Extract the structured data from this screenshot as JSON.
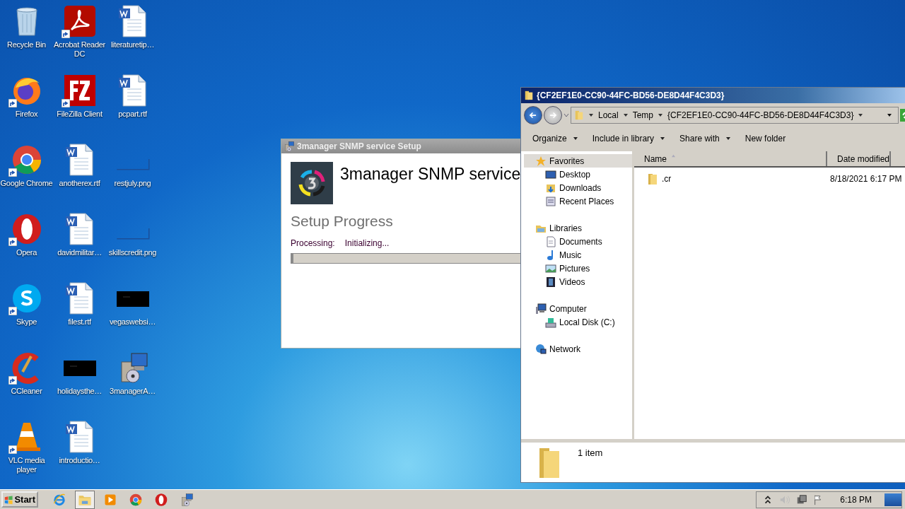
{
  "desktop": {
    "icons": [
      {
        "label": "Recycle Bin",
        "kind": "recycle",
        "shortcut": false
      },
      {
        "label": "Firefox",
        "kind": "firefox",
        "shortcut": true
      },
      {
        "label": "Google Chrome",
        "kind": "chrome",
        "shortcut": true
      },
      {
        "label": "Opera",
        "kind": "opera",
        "shortcut": true
      },
      {
        "label": "Skype",
        "kind": "skype",
        "shortcut": true
      },
      {
        "label": "CCleaner",
        "kind": "ccleaner",
        "shortcut": true
      },
      {
        "label": "VLC media player",
        "kind": "vlc",
        "shortcut": true
      },
      {
        "label": "Acrobat Reader DC",
        "kind": "pdf",
        "shortcut": true
      },
      {
        "label": "FileZilla Client",
        "kind": "filezilla",
        "shortcut": true
      },
      {
        "label": "anotherex.rtf",
        "kind": "word",
        "shortcut": false
      },
      {
        "label": "davidmilitar…",
        "kind": "word",
        "shortcut": false
      },
      {
        "label": "filest.rtf",
        "kind": "word",
        "shortcut": false
      },
      {
        "label": "holidaysthe…",
        "kind": "dark",
        "shortcut": false
      },
      {
        "label": "introductio…",
        "kind": "word",
        "shortcut": false
      },
      {
        "label": "literaturetip…",
        "kind": "word",
        "shortcut": false
      },
      {
        "label": "pcpart.rtf",
        "kind": "word",
        "shortcut": false
      },
      {
        "label": "restjuly.png",
        "kind": "image",
        "shortcut": false
      },
      {
        "label": "skillscredit.png",
        "kind": "image",
        "shortcut": false
      },
      {
        "label": "vegaswebsi…",
        "kind": "dark",
        "shortcut": false
      },
      {
        "label": "3managerA…",
        "kind": "installer",
        "shortcut": false
      }
    ]
  },
  "setup_window": {
    "title": "3manager SNMP service Setup",
    "heading": "3manager SNMP service",
    "section": "Setup Progress",
    "status_label": "Processing:",
    "status_value": "Initializing...",
    "progress": {
      "level": 0.01
    }
  },
  "explorer": {
    "title": "{CF2EF1E0-CC90-44FC-BD56-DE8D44F4C3D3}",
    "breadcrumb": [
      "Local",
      "Temp",
      "{CF2EF1E0-CC90-44FC-BD56-DE8D44F4C3D3}"
    ],
    "toolbar": [
      {
        "label": "Organize",
        "dropdown": true
      },
      {
        "label": "Include in library",
        "dropdown": true
      },
      {
        "label": "Share with",
        "dropdown": true
      },
      {
        "label": "New folder",
        "dropdown": false
      }
    ],
    "nav": [
      {
        "label": "Favorites",
        "kind": "star",
        "selected": true,
        "children": [
          {
            "label": "Desktop",
            "kind": "desktop",
            "selected": false
          },
          {
            "label": "Downloads",
            "kind": "downloads",
            "selected": false
          },
          {
            "label": "Recent Places",
            "kind": "recent",
            "selected": false
          }
        ]
      },
      {
        "label": "Libraries",
        "kind": "libraries",
        "selected": false,
        "children": [
          {
            "label": "Documents",
            "kind": "documents",
            "selected": false
          },
          {
            "label": "Music",
            "kind": "music",
            "selected": false
          },
          {
            "label": "Pictures",
            "kind": "pictures",
            "selected": false
          },
          {
            "label": "Videos",
            "kind": "videos",
            "selected": false
          }
        ]
      },
      {
        "label": "Computer",
        "kind": "computer",
        "selected": false,
        "children": [
          {
            "label": "Local Disk (C:)",
            "kind": "disk",
            "selected": false
          }
        ]
      },
      {
        "label": "Network",
        "kind": "network",
        "selected": false
      }
    ],
    "columns": [
      {
        "label": "Name",
        "sorted": true
      },
      {
        "label": "Date modified",
        "sorted": false
      }
    ],
    "rows": [
      {
        "name": ".cr",
        "date": "8/18/2021 6:17 PM",
        "selected": false
      }
    ],
    "status": "1 item"
  },
  "taskbar": {
    "start": "Start",
    "apps": [
      {
        "kind": "ie",
        "selected": false
      },
      {
        "kind": "explorer",
        "selected": true
      },
      {
        "kind": "media",
        "selected": false
      },
      {
        "kind": "chrome",
        "selected": false
      },
      {
        "kind": "opera",
        "selected": false
      },
      {
        "kind": "installer",
        "selected": false
      }
    ],
    "clock": "6:18 PM"
  }
}
